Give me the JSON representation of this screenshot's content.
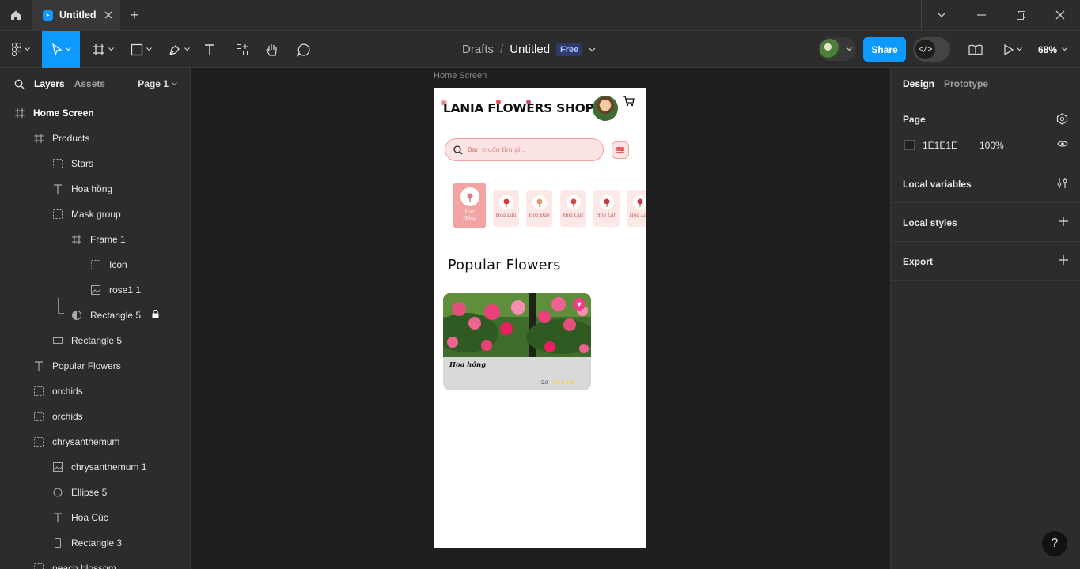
{
  "titlebar": {
    "tab_title": "Untitled",
    "new_tab": "+"
  },
  "toolbar": {
    "breadcrumb_drafts": "Drafts",
    "breadcrumb_sep": "/",
    "file_name": "Untitled",
    "plan_badge": "Free",
    "share_label": "Share",
    "zoom_level": "68%"
  },
  "left_panel": {
    "tab_layers": "Layers",
    "tab_assets": "Assets",
    "page_selector": "Page 1",
    "layers": [
      {
        "label": "Home Screen",
        "icon": "frame-icon"
      },
      {
        "label": "Products",
        "icon": "frame-icon"
      },
      {
        "label": "Stars",
        "icon": "group-icon"
      },
      {
        "label": "Hoa hồng",
        "icon": "text-icon"
      },
      {
        "label": "Mask group",
        "icon": "group-icon"
      },
      {
        "label": "Frame 1",
        "icon": "frame-icon"
      },
      {
        "label": "Icon",
        "icon": "group-icon"
      },
      {
        "label": "rose1 1",
        "icon": "image-icon"
      },
      {
        "label": "Rectangle 5",
        "icon": "mask-icon"
      },
      {
        "label": "Rectangle 5",
        "icon": "rectangle-icon"
      },
      {
        "label": "Popular Flowers",
        "icon": "text-icon"
      },
      {
        "label": "orchids",
        "icon": "group-icon"
      },
      {
        "label": "orchids",
        "icon": "group-icon"
      },
      {
        "label": "chrysanthemum",
        "icon": "group-icon"
      },
      {
        "label": "chrysanthemum 1",
        "icon": "image-icon"
      },
      {
        "label": "Ellipse 5",
        "icon": "ellipse-icon"
      },
      {
        "label": "Hoa Cúc",
        "icon": "text-icon"
      },
      {
        "label": "Rectangle 3",
        "icon": "rectangle-icon"
      },
      {
        "label": "peach blossom",
        "icon": "group-icon"
      }
    ]
  },
  "canvas": {
    "frame_label": "Home Screen",
    "app": {
      "shop_title": "LANIA FLOWERS SHOP",
      "search_placeholder": "Bạn muốn tìm gì...",
      "categories": [
        "Hoa Hồng",
        "Hoa Lan",
        "Hoa Đào",
        "Hoa Cúc",
        "Hoa Lan",
        "Hoa Lan"
      ],
      "section_title": "Popular Flowers",
      "product_name": "Hoa hồng",
      "product_rating": "5.0",
      "product_stars": "★★★★★"
    }
  },
  "right_panel": {
    "tab_design": "Design",
    "tab_prototype": "Prototype",
    "page_heading": "Page",
    "page_color": "1E1E1E",
    "page_opacity": "100%",
    "local_variables": "Local variables",
    "local_styles": "Local styles",
    "export": "Export"
  },
  "colors": {
    "accent": "#0d99ff",
    "panel": "#2c2c2c",
    "canvas": "#1e1e1e",
    "brand_pink": "#f4a3a3"
  },
  "help": "?"
}
